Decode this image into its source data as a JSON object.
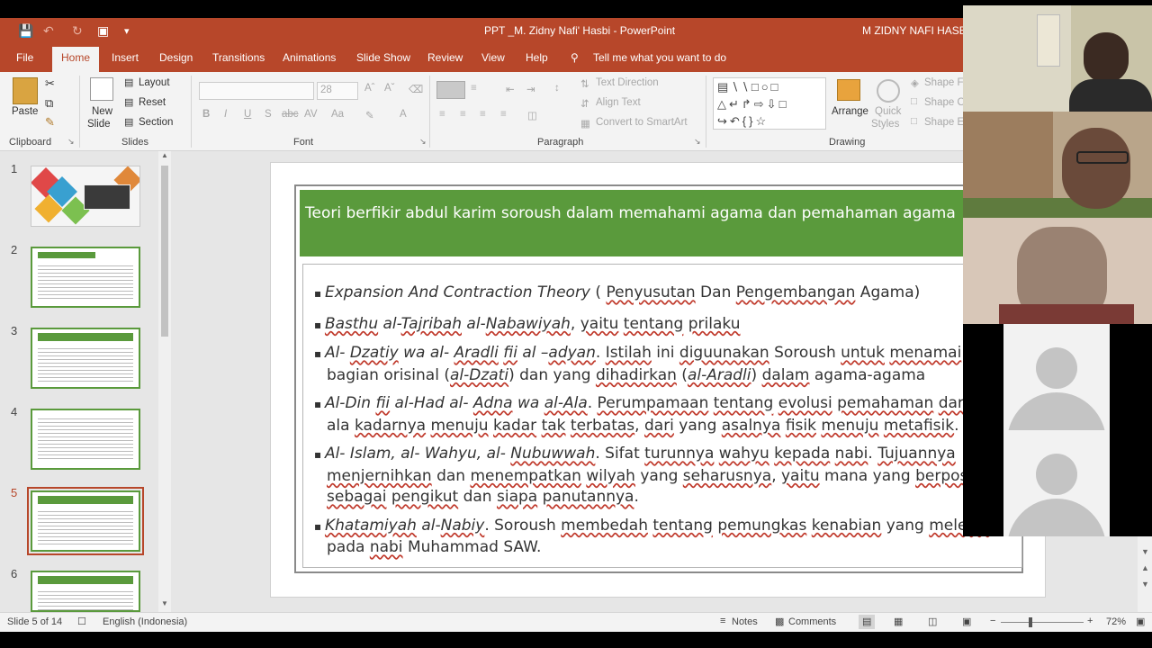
{
  "window": {
    "title": "PPT _M. Zidny Nafi' Hasbi  -  PowerPoint",
    "user": "M ZIDNY NAFI HASBI"
  },
  "tabs": [
    "File",
    "Home",
    "Insert",
    "Design",
    "Transitions",
    "Animations",
    "Slide Show",
    "Review",
    "View",
    "Help"
  ],
  "tell_me": "Tell me what you want to do",
  "ribbon": {
    "clipboard": {
      "paste": "Paste",
      "group": "Clipboard"
    },
    "slides": {
      "new_slide": "New",
      "new_slide2": "Slide",
      "layout": "Layout",
      "reset": "Reset",
      "section": "Section",
      "group": "Slides"
    },
    "font": {
      "size": "28",
      "group": "Font"
    },
    "paragraph": {
      "text_direction": "Text Direction",
      "align_text": "Align Text",
      "convert_smartart": "Convert to SmartArt",
      "group": "Paragraph"
    },
    "drawing": {
      "arrange": "Arrange",
      "quick_styles": "Quick",
      "quick_styles2": "Styles",
      "shape_fill": "Shape Fi",
      "shape_outline": "Shape O",
      "shape_effects": "Shape Ef",
      "group": "Drawing"
    }
  },
  "thumbnails": [
    "1",
    "2",
    "3",
    "4",
    "5",
    "6"
  ],
  "selected_slide": "5",
  "slide": {
    "title": "Teori berfikir abdul karim soroush dalam memahami agama dan pemahaman agama",
    "bullets": [
      {
        "marker": "▪",
        "parts": [
          [
            "Expansion And Contraction Theory",
            "it"
          ],
          [
            " ( ",
            ""
          ],
          [
            "Penyusutan",
            "ul"
          ],
          [
            " Dan ",
            ""
          ],
          [
            "Pengembangan",
            "ul"
          ],
          [
            " Agama)",
            ""
          ]
        ]
      },
      {
        "marker": "▪",
        "parts": [
          [
            "Basthu",
            "it ul"
          ],
          [
            " al-",
            "it"
          ],
          [
            "Tajribah",
            "it ul"
          ],
          [
            " al-",
            "it"
          ],
          [
            "Nabawiyah",
            "it ul"
          ],
          [
            ", ",
            ""
          ],
          [
            "yaitu",
            "ul"
          ],
          [
            " ",
            ""
          ],
          [
            "tentang",
            "ul"
          ],
          [
            " ",
            ""
          ],
          [
            "prilaku",
            "ul"
          ]
        ]
      },
      {
        "marker": "▪",
        "parts": [
          [
            "Al- ",
            "it"
          ],
          [
            "Dzatiy",
            "it ul"
          ],
          [
            " wa al- ",
            "it"
          ],
          [
            "Aradli",
            "it ul"
          ],
          [
            " ",
            "it"
          ],
          [
            "fii",
            "it ul"
          ],
          [
            " al –",
            "it"
          ],
          [
            "adyan",
            "it ul"
          ],
          [
            ". ",
            ""
          ],
          [
            "Istilah",
            "ul"
          ],
          [
            " ini ",
            ""
          ],
          [
            "diguunakan",
            "ul"
          ],
          [
            " Soroush ",
            ""
          ],
          [
            "untuk",
            "ul"
          ],
          [
            " ",
            ""
          ],
          [
            "menamai",
            "ul"
          ],
          [
            " bagian orisinal (",
            ""
          ],
          [
            "al-Dzati",
            "it ul"
          ],
          [
            ") dan yang ",
            ""
          ],
          [
            "dihadirkan",
            "ul"
          ],
          [
            " (",
            ""
          ],
          [
            "al-Aradli",
            "it ul"
          ],
          [
            ") ",
            ""
          ],
          [
            "dalam",
            "ul"
          ],
          [
            " agama-agama",
            ""
          ]
        ]
      },
      {
        "marker": "▪",
        "parts": [
          [
            "Al-Din ",
            "it"
          ],
          [
            "fii",
            "it ul"
          ],
          [
            " al-Had al- ",
            "it"
          ],
          [
            "Adna",
            "it ul"
          ],
          [
            " wa  ",
            "it"
          ],
          [
            "al-Ala",
            "it ul"
          ],
          [
            ". ",
            ""
          ],
          [
            "Perumpamaan",
            "ul"
          ],
          [
            " ",
            ""
          ],
          [
            "tentang",
            "ul"
          ],
          [
            " ",
            ""
          ],
          [
            "evolusi",
            "ul"
          ],
          [
            " ",
            ""
          ],
          [
            "pemahaman",
            "ul"
          ],
          [
            " ",
            ""
          ],
          [
            "dari",
            "ul"
          ],
          [
            " yang ala ",
            ""
          ],
          [
            "kadarnya",
            "ul"
          ],
          [
            " ",
            ""
          ],
          [
            "menuju",
            "ul"
          ],
          [
            " ",
            ""
          ],
          [
            "kadar",
            "ul"
          ],
          [
            " ",
            ""
          ],
          [
            "tak",
            "ul"
          ],
          [
            " ",
            ""
          ],
          [
            "terbatas",
            "ul"
          ],
          [
            ", ",
            ""
          ],
          [
            "dari",
            "ul"
          ],
          [
            " yang ",
            ""
          ],
          [
            "asalnya",
            "ul"
          ],
          [
            " ",
            ""
          ],
          [
            "fisik",
            "ul"
          ],
          [
            " ",
            ""
          ],
          [
            "menuju",
            "ul"
          ],
          [
            " ",
            ""
          ],
          [
            "metafisik",
            "ul"
          ],
          [
            ".",
            ""
          ]
        ]
      },
      {
        "marker": "▪",
        "parts": [
          [
            "Al- Islam, al- Wahyu, al- ",
            "it"
          ],
          [
            "Nubuwwah",
            "it ul"
          ],
          [
            ". Sifat ",
            ""
          ],
          [
            "turunnya",
            "ul"
          ],
          [
            " ",
            ""
          ],
          [
            "wahyu",
            "ul"
          ],
          [
            " ",
            ""
          ],
          [
            "kepada",
            "ul"
          ],
          [
            " ",
            ""
          ],
          [
            "nabi",
            "ul"
          ],
          [
            ". ",
            ""
          ],
          [
            "Tujuannya",
            "ul"
          ],
          [
            " ",
            ""
          ],
          [
            "menjernihkan",
            "ul"
          ],
          [
            " dan ",
            ""
          ],
          [
            "menempatkan",
            "ul"
          ],
          [
            " ",
            ""
          ],
          [
            "wilyah",
            "ul"
          ],
          [
            " yang ",
            ""
          ],
          [
            "seharusnya",
            "ul"
          ],
          [
            ", ",
            ""
          ],
          [
            "yaitu",
            "ul"
          ],
          [
            " mana yang ",
            ""
          ],
          [
            "berposisi",
            "ul"
          ],
          [
            " ",
            ""
          ],
          [
            "sebagai",
            "ul"
          ],
          [
            " ",
            ""
          ],
          [
            "pengikut",
            "ul"
          ],
          [
            " dan ",
            ""
          ],
          [
            "siapa",
            "ul"
          ],
          [
            " ",
            ""
          ],
          [
            "panutannya",
            "ul"
          ],
          [
            ".",
            ""
          ]
        ]
      },
      {
        "marker": "▪",
        "parts": [
          [
            "Khatamiyah",
            "it ul"
          ],
          [
            " al-",
            "it"
          ],
          [
            "Nabiy",
            "it ul"
          ],
          [
            ". Soroush ",
            ""
          ],
          [
            "membedah",
            "ul"
          ],
          [
            " ",
            ""
          ],
          [
            "tentang",
            "ul"
          ],
          [
            " ",
            ""
          ],
          [
            "pemungkas",
            "ul"
          ],
          [
            " ",
            ""
          ],
          [
            "kenabian",
            "ul"
          ],
          [
            " yang ",
            ""
          ],
          [
            "melekat",
            "ul"
          ],
          [
            " pada ",
            ""
          ],
          [
            "nabi",
            "ul"
          ],
          [
            " Muhammad SAW.",
            ""
          ]
        ]
      }
    ]
  },
  "status": {
    "slide_of": "Slide 5 of 14",
    "language": "English (Indonesia)",
    "notes": "Notes",
    "comments": "Comments",
    "zoom": "72%"
  },
  "colors": {
    "accent": "#b7472a",
    "slide_title_bg": "#5a9a3c",
    "selected_thumb": "#b7472a"
  }
}
